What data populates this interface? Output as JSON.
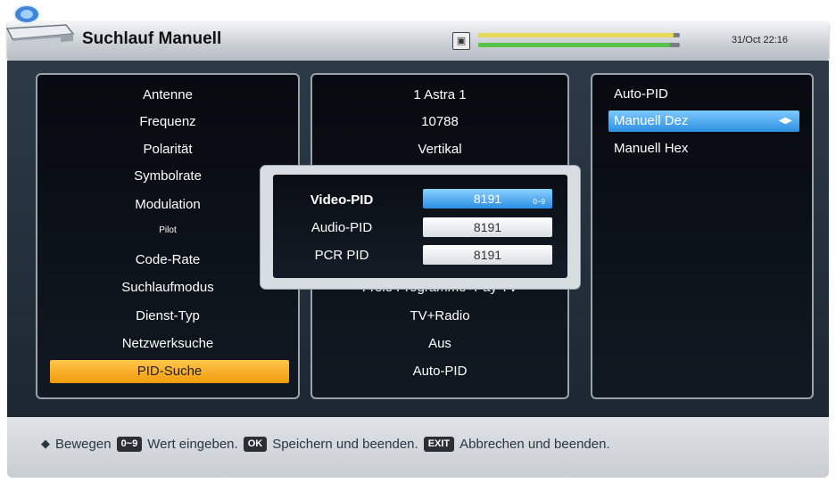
{
  "header": {
    "title": "Suchlauf Manuell",
    "datetime": "31/Oct 22:16",
    "signal_icon": "signal-strength-icon",
    "signal_strength": 0.97,
    "signal_quality": 0.95
  },
  "colors": {
    "selection_orange": "#f5a623",
    "selection_blue": "#3a9bea",
    "strength_yellow": "#e8d85a",
    "quality_green": "#56c24a"
  },
  "settings": [
    {
      "label": "Antenne",
      "value": "1 Astra 1"
    },
    {
      "label": "Frequenz",
      "value": "10788"
    },
    {
      "label": "Polarität",
      "value": "Vertikal"
    },
    {
      "label": "Symbolrate",
      "value": ""
    },
    {
      "label": "Modulation",
      "value": ""
    },
    {
      "label": "Pilot",
      "value": ""
    },
    {
      "label": "Code-Rate",
      "value": ""
    },
    {
      "label": "Suchlaufmodus",
      "value": "Freie Programme+Pay TV"
    },
    {
      "label": "Dienst-Typ",
      "value": "TV+Radio"
    },
    {
      "label": "Netzwerksuche",
      "value": "Aus"
    },
    {
      "label": "PID-Suche",
      "value": "Auto-PID"
    }
  ],
  "selected_setting_index": 10,
  "pid_options": [
    {
      "label": "Auto-PID"
    },
    {
      "label": "Manuell Dez"
    },
    {
      "label": "Manuell Hex"
    }
  ],
  "selected_option_index": 1,
  "pid_popup": {
    "video_label": "Video-PID",
    "video_value": "8191",
    "video_hint": "0~9",
    "audio_label": "Audio-PID",
    "audio_value": "8191",
    "pcr_label": "PCR PID",
    "pcr_value": "8191"
  },
  "footer": {
    "move_icon": "up-down-arrow-icon",
    "move_label": "Bewegen",
    "key_digits": "0~9",
    "digits_label": "Wert eingeben.",
    "key_ok": "OK",
    "ok_label": "Speichern und beenden.",
    "key_exit": "EXIT",
    "exit_label": "Abbrechen und beenden."
  }
}
